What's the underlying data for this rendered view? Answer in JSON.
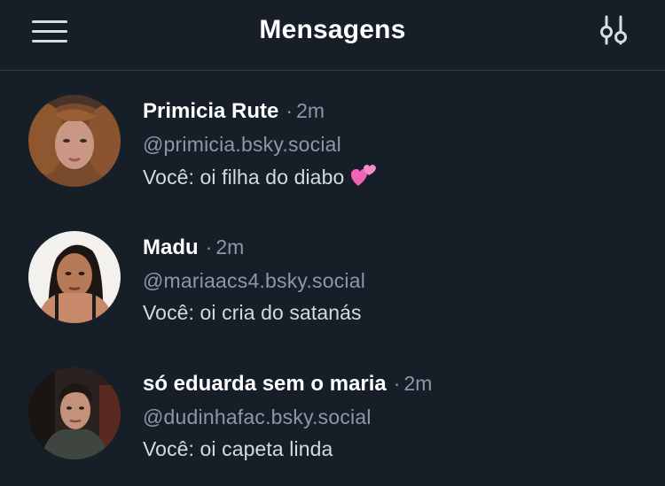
{
  "header": {
    "title": "Mensagens",
    "menu_icon": "hamburger-menu-icon",
    "settings_icon": "sliders-icon"
  },
  "conversations": [
    {
      "name": "Primicia Rute",
      "separator": "·",
      "time": "2m",
      "handle": "@primicia.bsky.social",
      "preview": "Você: oi filha do diabo",
      "emoji": "two-hearts-icon"
    },
    {
      "name": "Madu",
      "separator": "·",
      "time": "2m",
      "handle": "@mariaacs4.bsky.social",
      "preview": "Você: oi cria do satanás"
    },
    {
      "name": "só eduarda sem o maria",
      "separator": "·",
      "time": "2m",
      "handle": "@dudinhafac.bsky.social",
      "preview": "Você: oi capeta linda"
    }
  ],
  "colors": {
    "background": "#161e27",
    "divider": "#2e3945",
    "muted_text": "#8d97a5",
    "preview_text": "#d4dae2"
  }
}
